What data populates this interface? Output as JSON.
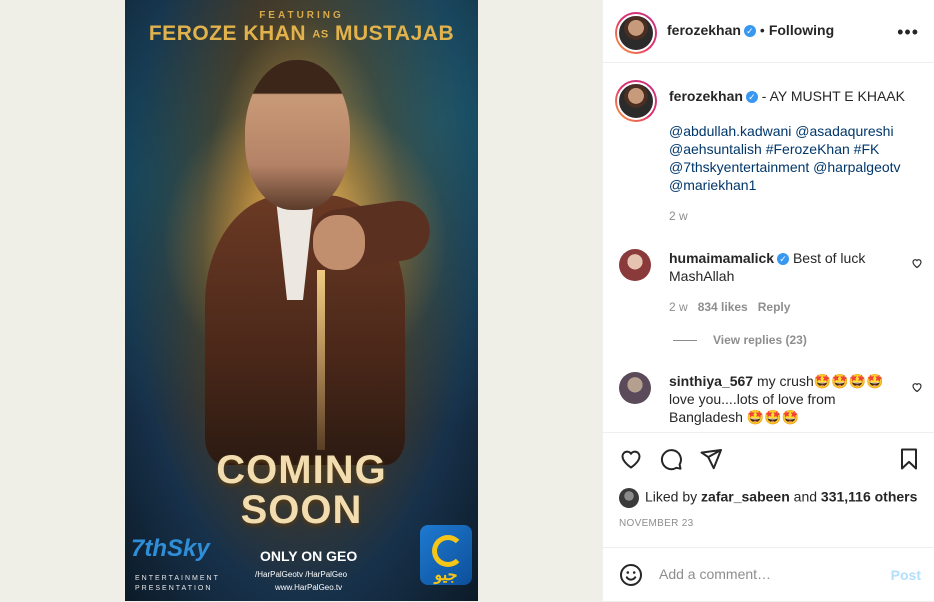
{
  "poster": {
    "featuring": "FEATURING",
    "title_name": "FEROZE KHAN",
    "title_as": "AS",
    "title_role": "MUSTAJAB",
    "coming": "COMING",
    "soon": "SOON",
    "brand": "7thSky",
    "brand_sub": "ENTERTAINMENT PRESENTATION",
    "only_on": "ONLY ON GEO",
    "social": "/HarPalGeotv  /HarPalGeo",
    "url": "www.HarPalGeo.tv",
    "geo_urdu": "جیو"
  },
  "header": {
    "username": "ferozekhan",
    "following": "Following",
    "more": "•••"
  },
  "caption": {
    "username": "ferozekhan",
    "text": " - AY MUSHT E KHAAK",
    "tags": [
      "@abdullah.kadwani",
      "@asadaqureshi",
      "@aehsuntalish",
      "#FerozeKhan",
      "#FK",
      "@7thskyentertainment",
      "@harpalgeotv",
      "@mariekhan1"
    ],
    "time": "2 w"
  },
  "comments": [
    {
      "username": "humaimamalick",
      "text": "Best of luck MashAllah",
      "time": "2 w",
      "likes": "834 likes",
      "reply": "Reply",
      "view_replies": "View replies (23)"
    },
    {
      "username": "sinthiya_567",
      "text": "my crush🤩🤩🤩🤩 love you....lots of love from Bangladesh 🤩🤩🤩"
    }
  ],
  "likes": {
    "prefix": "Liked by ",
    "user": "zafar_sabeen",
    "middle": " and ",
    "count": "331,116 others"
  },
  "date": "NOVEMBER 23",
  "comment_box": {
    "placeholder": "Add a comment…",
    "post": "Post"
  },
  "colors": {
    "link": "#00376b",
    "verified": "#3897f0",
    "muted": "#8e8e8e",
    "post_disabled": "#b2dffc"
  }
}
